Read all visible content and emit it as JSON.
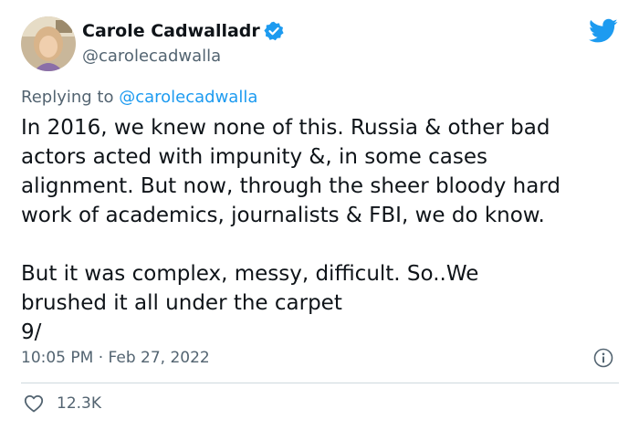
{
  "user": {
    "display_name": "Carole Cadwalladr",
    "handle": "@carolecadwalla",
    "verified": true
  },
  "reply": {
    "prefix": "Replying to ",
    "to": "@carolecadwalla"
  },
  "tweet": {
    "paragraphs": [
      [
        "In 2016, we knew none of this. Russia & other bad",
        "actors acted with impunity &, in some cases",
        "alignment. But now, through the sheer bloody hard",
        "work of academics, journalists & FBI, we do know."
      ],
      [
        "But it was complex, messy, difficult. So..We",
        "brushed it all under the carpet",
        "9/"
      ]
    ],
    "time": "10:05 PM",
    "separator": " · ",
    "date": "Feb 27, 2022"
  },
  "actions": {
    "like_count": "12.3K"
  },
  "colors": {
    "brand": "#1d9bf0",
    "text": "#0f1419",
    "secondary_text": "#536471",
    "divider": "#cfd9de"
  },
  "icons": {
    "logo": "twitter-bird-icon",
    "verified": "verified-badge-icon",
    "info": "info-icon",
    "like": "heart-icon"
  }
}
